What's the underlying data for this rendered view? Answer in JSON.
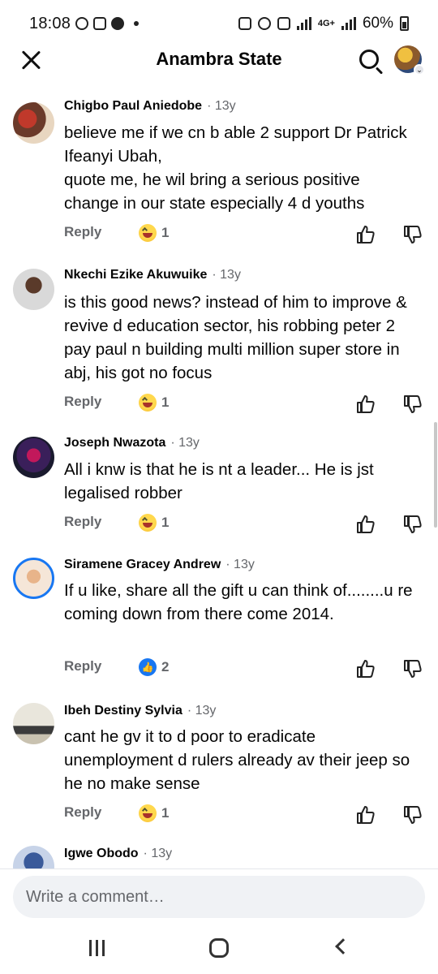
{
  "status_bar": {
    "time": "18:08",
    "net_tag": "4G+",
    "battery": "60%",
    "left_icons": [
      "whatsapp-icon",
      "gallery-icon",
      "facebook-icon"
    ],
    "right_icons": [
      "lock-icon",
      "alarm-icon",
      "mute-icon",
      "signal-icon",
      "signal-icon",
      "battery-icon"
    ]
  },
  "header": {
    "title": "Anambra State",
    "close_icon": "close-icon",
    "search_icon": "search-icon"
  },
  "comments": [
    {
      "name": "Chigbo Paul Aniedobe",
      "time": "· 13y",
      "text": "believe me if we cn b able 2 support Dr Patrick Ifeanyi Ubah,\nquote me, he wil bring a serious positive change in our state especially 4 d youths",
      "reply": "Reply",
      "reaction": "haha",
      "reaction_count": "1"
    },
    {
      "name": "Nkechi Ezike Akuwuike",
      "time": "· 13y",
      "text": "is this good news? instead of him to improve & revive d education sector, his robbing peter 2 pay paul n building multi million super store in abj, his got no focus",
      "reply": "Reply",
      "reaction": "haha",
      "reaction_count": "1"
    },
    {
      "name": "Joseph Nwazota",
      "time": "· 13y",
      "text": "All i knw is that he is nt a leader... He is jst legalised robber",
      "reply": "Reply",
      "reaction": "haha",
      "reaction_count": "1"
    },
    {
      "name": "Siramene Gracey Andrew",
      "time": "· 13y",
      "text": "If u like, share all the gift u can think of........u re coming down from there come 2014.",
      "reply": "Reply",
      "reaction": "like",
      "reaction_count": "2"
    },
    {
      "name": "Ibeh Destiny Sylvia",
      "time": "· 13y",
      "text": "cant he gv it to d poor to eradicate unemployment d rulers already av their jeep so he no make sense",
      "reply": "Reply",
      "reaction": "haha",
      "reaction_count": "1"
    },
    {
      "name": "Igwe Obodo",
      "time": "· 13y"
    }
  ],
  "composer": {
    "placeholder": "Write a comment…"
  },
  "nav": {
    "icons": [
      "recents-icon",
      "home-icon",
      "back-icon"
    ]
  }
}
